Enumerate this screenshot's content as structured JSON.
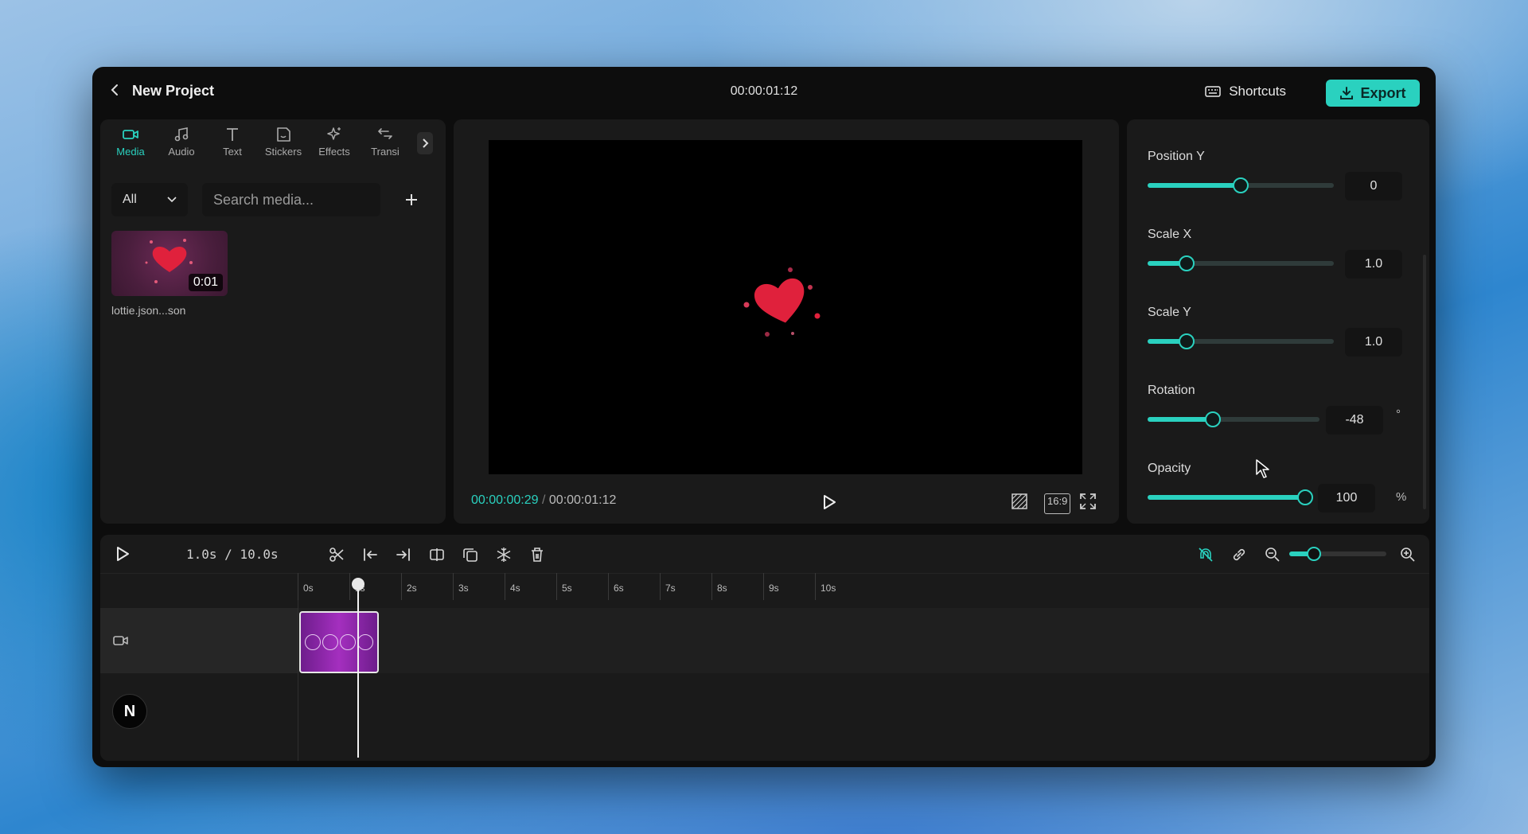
{
  "header": {
    "back_icon": "chevron-left-icon",
    "project_title": "New Project",
    "timecode": "00:00:01:12",
    "shortcuts_label": "Shortcuts",
    "export_label": "Export"
  },
  "media_panel": {
    "tabs": [
      {
        "label": "Media",
        "icon": "video-camera-icon",
        "active": true
      },
      {
        "label": "Audio",
        "icon": "music-note-icon",
        "active": false
      },
      {
        "label": "Text",
        "icon": "text-icon",
        "active": false
      },
      {
        "label": "Stickers",
        "icon": "sticker-icon",
        "active": false
      },
      {
        "label": "Effects",
        "icon": "sparkle-icon",
        "active": false
      },
      {
        "label": "Transi",
        "icon": "transition-icon",
        "active": false
      }
    ],
    "filter_value": "All",
    "search_placeholder": "Search media...",
    "items": [
      {
        "name": "lottie.json...son",
        "duration": "0:01"
      }
    ]
  },
  "preview": {
    "current_time": "00:00:00:29",
    "separator": "/",
    "total_time": "00:00:01:12",
    "aspect_ratio": "16:9"
  },
  "properties": [
    {
      "label": "Position Y",
      "value": "0",
      "unit": "",
      "fraction": 0.5
    },
    {
      "label": "Scale X",
      "value": "1.0",
      "unit": "",
      "fraction": 0.21
    },
    {
      "label": "Scale Y",
      "value": "1.0",
      "unit": "",
      "fraction": 0.21
    },
    {
      "label": "Rotation",
      "value": "-48",
      "unit": "°",
      "fraction": 0.38
    },
    {
      "label": "Opacity",
      "value": "100",
      "unit": "%",
      "fraction": 1.0
    }
  ],
  "timeline": {
    "time_display": "1.0s / 10.0s",
    "ruler": [
      "0s",
      "1s",
      "2s",
      "3s",
      "4s",
      "5s",
      "6s",
      "7s",
      "8s",
      "9s",
      "10s"
    ],
    "zoom_fraction": 0.25,
    "logo_letter": "N"
  },
  "colors": {
    "accent": "#2ad1bf",
    "heart": "#e0213c",
    "clip": "#a42fbf"
  }
}
